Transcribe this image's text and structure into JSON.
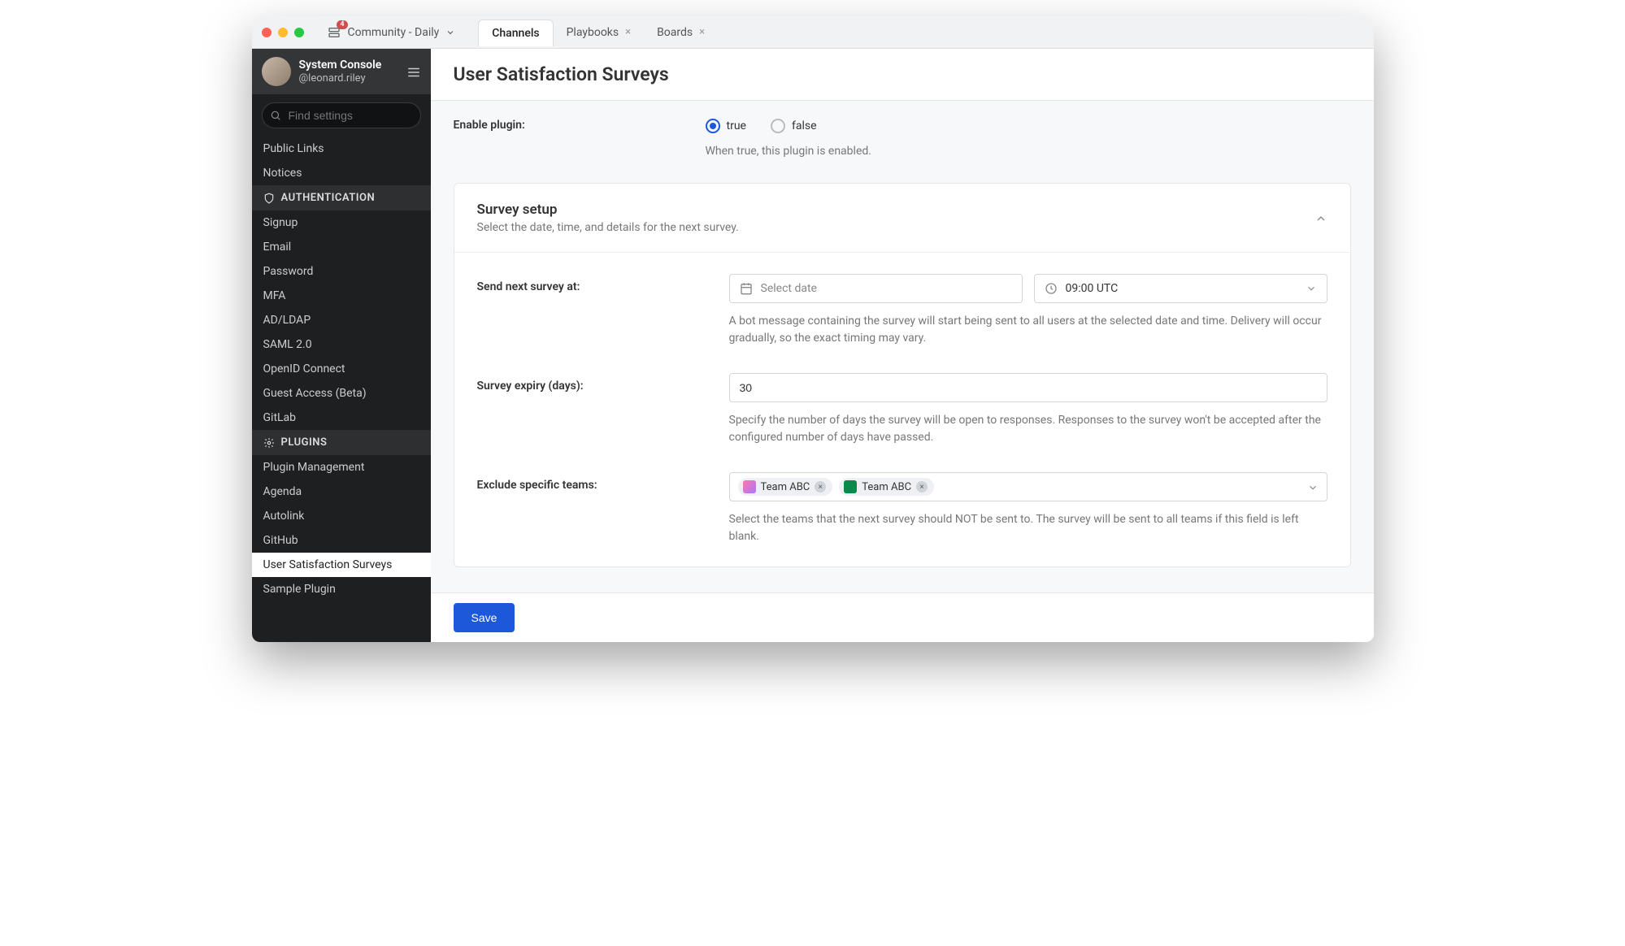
{
  "titlebar": {
    "server_name": "Community - Daily",
    "badge_count": "4",
    "tabs": [
      {
        "label": "Channels",
        "active": true,
        "closable": false
      },
      {
        "label": "Playbooks",
        "active": false,
        "closable": true
      },
      {
        "label": "Boards",
        "active": false,
        "closable": true
      }
    ]
  },
  "sidebar": {
    "title": "System Console",
    "username": "@leonard.riley",
    "search_placeholder": "Find settings",
    "items_pre": [
      "Public Links",
      "Notices"
    ],
    "section_auth": "AUTHENTICATION",
    "auth_items": [
      "Signup",
      "Email",
      "Password",
      "MFA",
      "AD/LDAP",
      "SAML 2.0",
      "OpenID Connect",
      "Guest Access (Beta)",
      "GitLab"
    ],
    "section_plugins": "PLUGINS",
    "plugin_items": [
      "Plugin Management",
      "Agenda",
      "Autolink",
      "GitHub",
      "User Satisfaction Surveys",
      "Sample Plugin"
    ],
    "active_item": "User Satisfaction Surveys"
  },
  "page": {
    "title": "User Satisfaction Surveys",
    "enable_label": "Enable plugin:",
    "radio_true": "true",
    "radio_false": "false",
    "enable_help": "When true, this plugin is enabled.",
    "card": {
      "title": "Survey setup",
      "subtitle": "Select the date, time, and details for the next survey."
    },
    "send_label": "Send next survey at:",
    "date_placeholder": "Select date",
    "time_value": "09:00 UTC",
    "send_help": "A bot message containing the survey will start being sent to all users at the selected date and time. Delivery will occur gradually, so the exact timing may vary.",
    "expiry_label": "Survey expiry (days):",
    "expiry_value": "30",
    "expiry_help": "Specify the number of days the survey will be open to responses. Responses to the survey won't be accepted after the configured number of days have passed.",
    "exclude_label": "Exclude specific teams:",
    "exclude_chips": [
      "Team ABC",
      "Team ABC"
    ],
    "exclude_help": "Select the teams that the next survey should NOT be sent to. The survey will be sent to all teams if this field is left blank.",
    "save_label": "Save"
  }
}
